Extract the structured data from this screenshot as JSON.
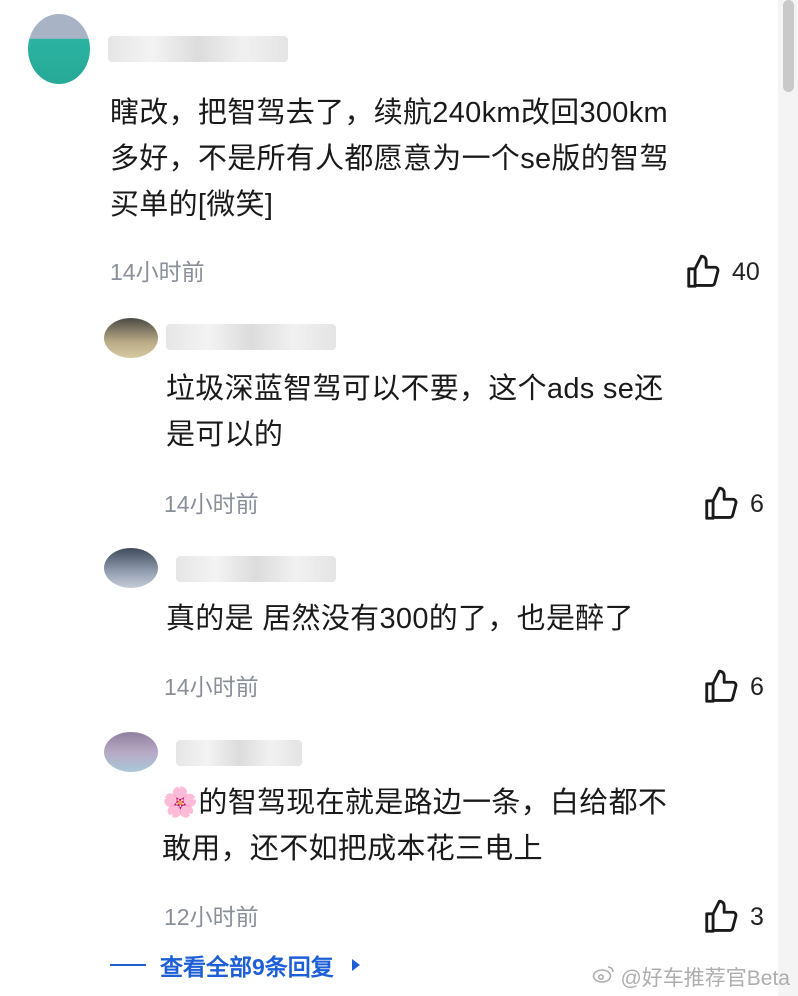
{
  "comments": [
    {
      "text": "瞎改，把智驾去了，续航240km改回300km\n多好，不是所有人都愿意为一个se版的智驾\n买单的[微笑]",
      "time": "14小时前",
      "likes": "40"
    }
  ],
  "replies": [
    {
      "text": "垃圾深蓝智驾可以不要，这个ads se还\n是可以的",
      "time": "14小时前",
      "likes": "6"
    },
    {
      "text": "真的是 居然没有300的了，也是醉了",
      "time": "14小时前",
      "likes": "6"
    },
    {
      "text": "🌸的智驾现在就是路边一条，白给都不\n敢用，还不如把成本花三电上",
      "time": "12小时前",
      "likes": "3"
    }
  ],
  "expand": {
    "label": "查看全部9条回复"
  },
  "watermark": {
    "label": "@好车推荐官Beta"
  },
  "colors": {
    "link": "#1e5fd6",
    "meta": "#8a8f99"
  }
}
